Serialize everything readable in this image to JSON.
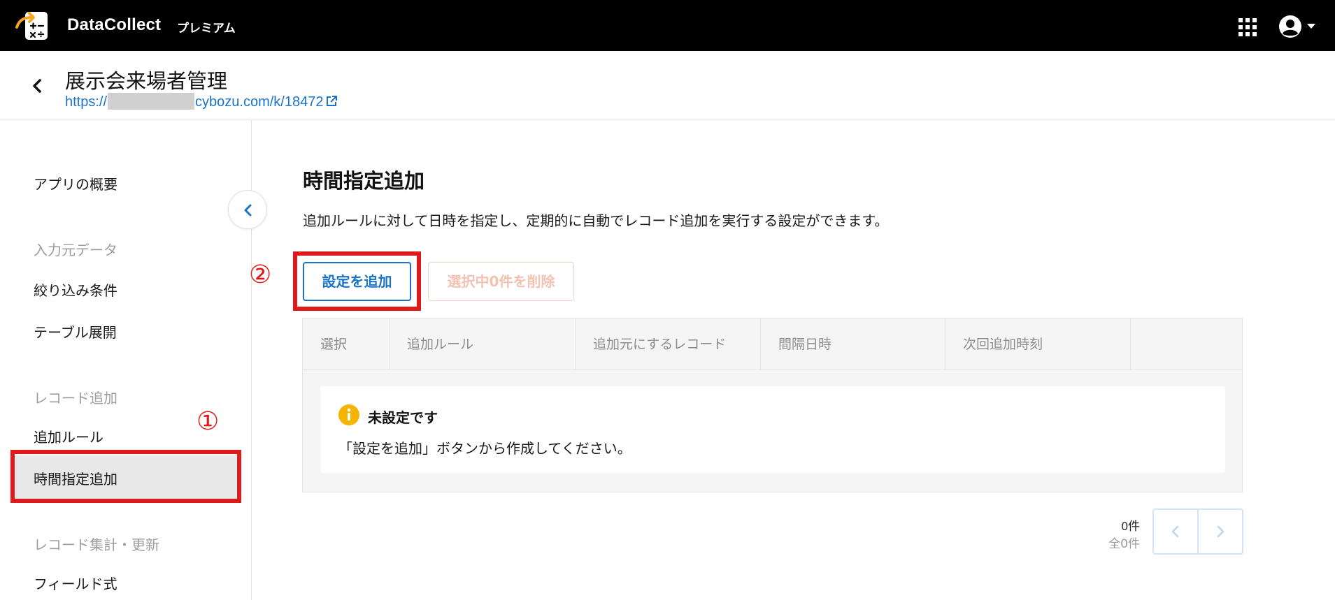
{
  "topbar": {
    "brand": "DataCollect",
    "plan": "プレミアム",
    "icons": {
      "logo": "calculator-arrow-logo",
      "apps": "grid-apps-icon",
      "user": "user-account-icon"
    },
    "background": "#000000"
  },
  "header": {
    "title": "展示会来場者管理",
    "url_prefix": "https://",
    "url_suffix": "cybozu.com/k/18472"
  },
  "sidebar": {
    "overview": "アプリの概要",
    "group_input": "入力元データ",
    "filter": "絞り込み条件",
    "table_expand": "テーブル展開",
    "group_record_add": "レコード追加",
    "add_rule": "追加ルール",
    "scheduled_add": "時間指定追加",
    "group_aggregate": "レコード集計・更新",
    "field_formula": "フィールド式"
  },
  "annotations": {
    "marker1": "①",
    "marker2": "②",
    "color": "#e01a1a"
  },
  "main": {
    "title": "時間指定追加",
    "description": "追加ルールに対して日時を指定し、定期的に自動でレコード追加を実行する設定ができます。",
    "add_button": "設定を追加",
    "delete_button": "選択中0件を削除",
    "columns": [
      "選択",
      "追加ルール",
      "追加元にするレコード",
      "間隔日時",
      "次回追加時刻",
      ""
    ],
    "empty_title": "未設定です",
    "empty_message": "「設定を追加」ボタンから作成してください。",
    "count": "0件",
    "total": "全0件"
  },
  "colors": {
    "accent": "#1a73c7",
    "info": "#f5b400",
    "disabled": "#f2c2b2"
  }
}
